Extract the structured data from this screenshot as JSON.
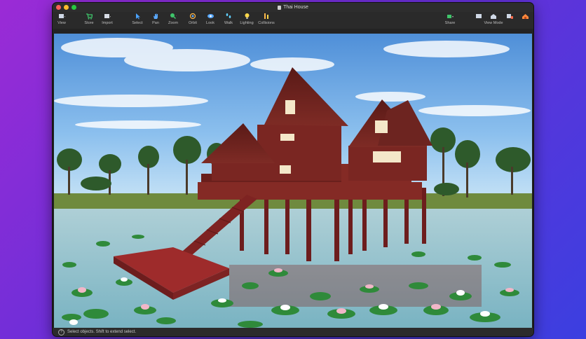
{
  "window": {
    "title": "Thai House"
  },
  "toolbar": {
    "view": "View",
    "store": "Store",
    "import": "Import",
    "select": "Select",
    "pan": "Pan",
    "zoom": "Zoom",
    "orbit": "Orbit",
    "look": "Look",
    "walk": "Walk",
    "lighting": "Lighting",
    "collisions": "Collisions",
    "share": "Share",
    "view_mode": "View Mode"
  },
  "status": {
    "message": "Select objects. Shift to extend select."
  },
  "colors": {
    "accent": "#3a8ee6",
    "house": "#7a1f22",
    "water": "#8fc1c9",
    "lilypad": "#2f8a3a"
  }
}
